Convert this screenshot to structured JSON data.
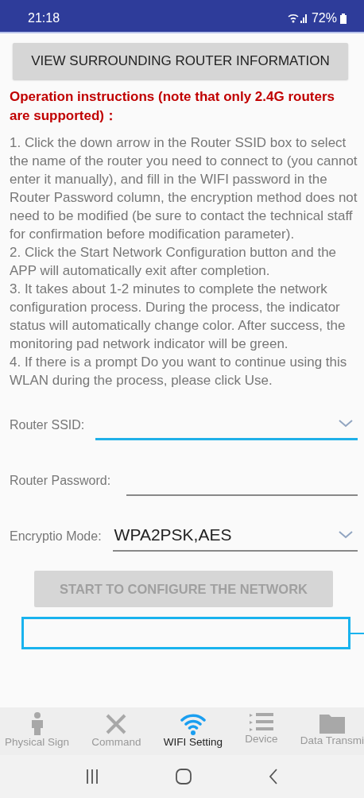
{
  "status_bar": {
    "time": "21:18",
    "battery": "72%"
  },
  "view_button": {
    "label": "VIEW SURROUNDING ROUTER INFORMATION"
  },
  "instructions": {
    "heading": "Operation instructions (note that only 2.4G routers are supported)：",
    "paragraphs": [
      "1. Click the down arrow in the Router SSID box to select the name of the router you need to connect to (you cannot enter it manually), and fill in the WIFI password in the Router Password column, the encryption method does not need to be modified (be sure to contact the technical staff for confirmation before modification parameter).",
      "2. Click the Start Network Configuration button and the APP will automatically exit after completion.",
      "3. It takes about 1-2 minutes to complete the network configuration process. During the process, the indicator status will automatically change color. After success, the monitoring pad network indicator will be green.",
      "4. If there is a prompt Do you want to continue using this WLAN during the process, please click Use."
    ]
  },
  "fields": [
    {
      "kind": "dropdown",
      "label": "Router SSID:",
      "focused": true
    },
    {
      "kind": "text",
      "label": "Router Password:",
      "focused": false
    },
    {
      "kind": "dropdown",
      "label": "Encryptio Mode:",
      "value": "WPA2PSK,AES",
      "focused": false
    }
  ],
  "start_button": {
    "label": "START TO CONFIGURE THE NETWORK",
    "disabled": true
  },
  "tabs": [
    {
      "label": "Physical Sign",
      "selected": false
    },
    {
      "label": "Command",
      "selected": false
    },
    {
      "label": "WIFI Setting",
      "selected": true
    },
    {
      "label": "Device",
      "selected": false
    },
    {
      "label": "Data Transmi",
      "selected": false
    }
  ]
}
